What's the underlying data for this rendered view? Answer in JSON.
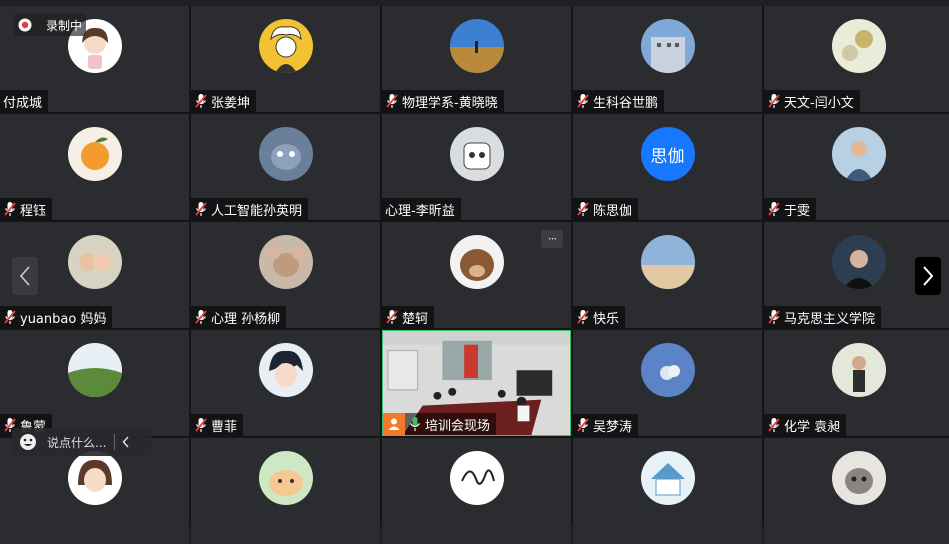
{
  "recording": {
    "label": "录制中"
  },
  "chat": {
    "placeholder": "说点什么..."
  },
  "participants": [
    {
      "name": "付成城",
      "avatar": "avatar-girl-cartoon",
      "mic": "none"
    },
    {
      "name": "张姜坤",
      "avatar": "avatar-boy-cartoon",
      "mic": "muted"
    },
    {
      "name": "物理学系-黄晓晓",
      "avatar": "avatar-field-photo",
      "mic": "muted"
    },
    {
      "name": "生科谷世鹏",
      "avatar": "avatar-building-photo",
      "mic": "muted"
    },
    {
      "name": "天文-闫小文",
      "avatar": "avatar-flower-photo",
      "mic": "muted"
    },
    {
      "name": "程钰",
      "avatar": "avatar-orange",
      "mic": "muted"
    },
    {
      "name": "人工智能孙英明",
      "avatar": "avatar-cat-cartoon",
      "mic": "muted"
    },
    {
      "name": "心理-李昕益",
      "avatar": "avatar-cup-cartoon",
      "mic": "none"
    },
    {
      "name": "陈思伽",
      "avatar": "avatar-text",
      "avatar_text": "思伽",
      "mic": "muted"
    },
    {
      "name": "于雯",
      "avatar": "avatar-person-photo",
      "mic": "muted"
    },
    {
      "name": "yuanbao 妈妈",
      "avatar": "avatar-kids-photo",
      "mic": "muted"
    },
    {
      "name": "心理 孙杨柳",
      "avatar": "avatar-mouse-cartoon",
      "mic": "muted"
    },
    {
      "name": "楚轲",
      "avatar": "avatar-bear-photo",
      "mic": "muted",
      "more": "···"
    },
    {
      "name": "快乐",
      "avatar": "avatar-sky-photo",
      "mic": "muted"
    },
    {
      "name": "马克思主义学院",
      "avatar": "avatar-man-photo",
      "mic": "muted"
    },
    {
      "name": "鲁蒙",
      "avatar": "avatar-landscape-photo",
      "mic": "muted"
    },
    {
      "name": "曹菲",
      "avatar": "avatar-anime-boy",
      "mic": "muted"
    },
    {
      "name": "培训会现场",
      "avatar": "video-meeting-room",
      "mic": "on"
    },
    {
      "name": "吴梦涛",
      "avatar": "avatar-cloud-photo",
      "mic": "muted"
    },
    {
      "name": "化学 袁昶",
      "avatar": "avatar-woman-photo",
      "mic": "muted"
    },
    {
      "name": "",
      "avatar": "avatar-girl-anime",
      "mic": "none"
    },
    {
      "name": "",
      "avatar": "avatar-hamster-cartoon",
      "mic": "none"
    },
    {
      "name": "",
      "avatar": "avatar-signature",
      "mic": "none"
    },
    {
      "name": "",
      "avatar": "avatar-house-cartoon",
      "mic": "none"
    },
    {
      "name": "",
      "avatar": "avatar-cat-photo",
      "mic": "none"
    }
  ],
  "colors": {
    "accent_blue": "#1677ff",
    "mic_red": "#e23d3d",
    "mic_green": "#38c45c",
    "video_border": "#39c36d"
  }
}
